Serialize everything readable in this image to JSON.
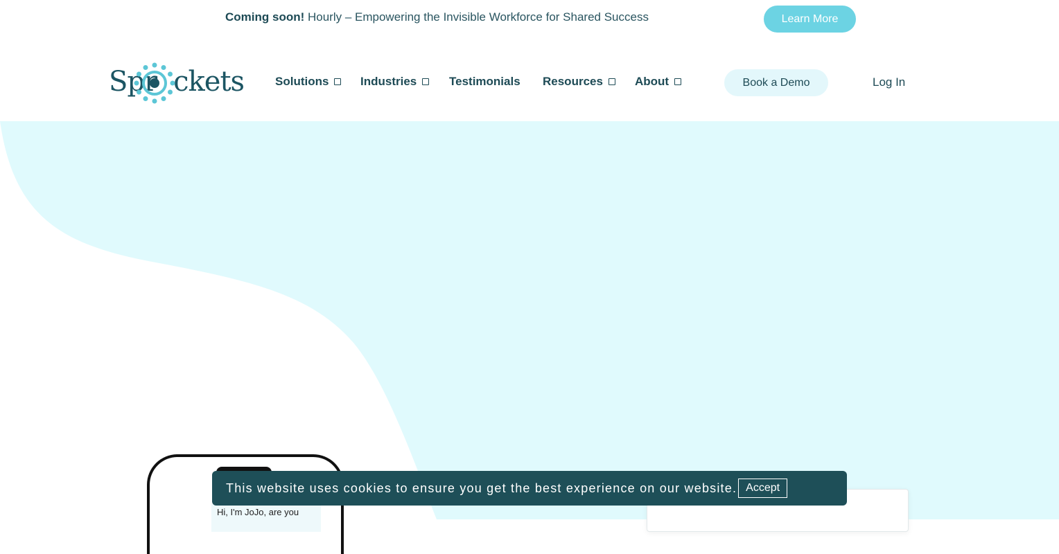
{
  "announcement": {
    "bold": "Coming soon!",
    "text": " Hourly – Empowering the Invisible Workforce for Shared Success",
    "cta": "Learn More"
  },
  "header": {
    "logo_text_left": "Spr",
    "logo_text_right": "ckets",
    "nav": [
      {
        "label": "Solutions",
        "dropdown": true
      },
      {
        "label": "Industries",
        "dropdown": true
      },
      {
        "label": "Testimonials",
        "dropdown": false
      },
      {
        "label": "Resources",
        "dropdown": true
      },
      {
        "label": "About",
        "dropdown": true
      }
    ],
    "book_demo": "Book a Demo",
    "login": "Log In"
  },
  "hero": {
    "chat_message": "Hi, I'm JoJo, are you"
  },
  "cookie": {
    "message": "This website uses cookies to ensure you get the best experience on our website.",
    "accept": "Accept"
  },
  "colors": {
    "brand_dark": "#1d4a55",
    "accent_teal": "#6cd3e3",
    "hero_bg": "#e0fafd",
    "cookie_bg": "#1e4f58"
  }
}
